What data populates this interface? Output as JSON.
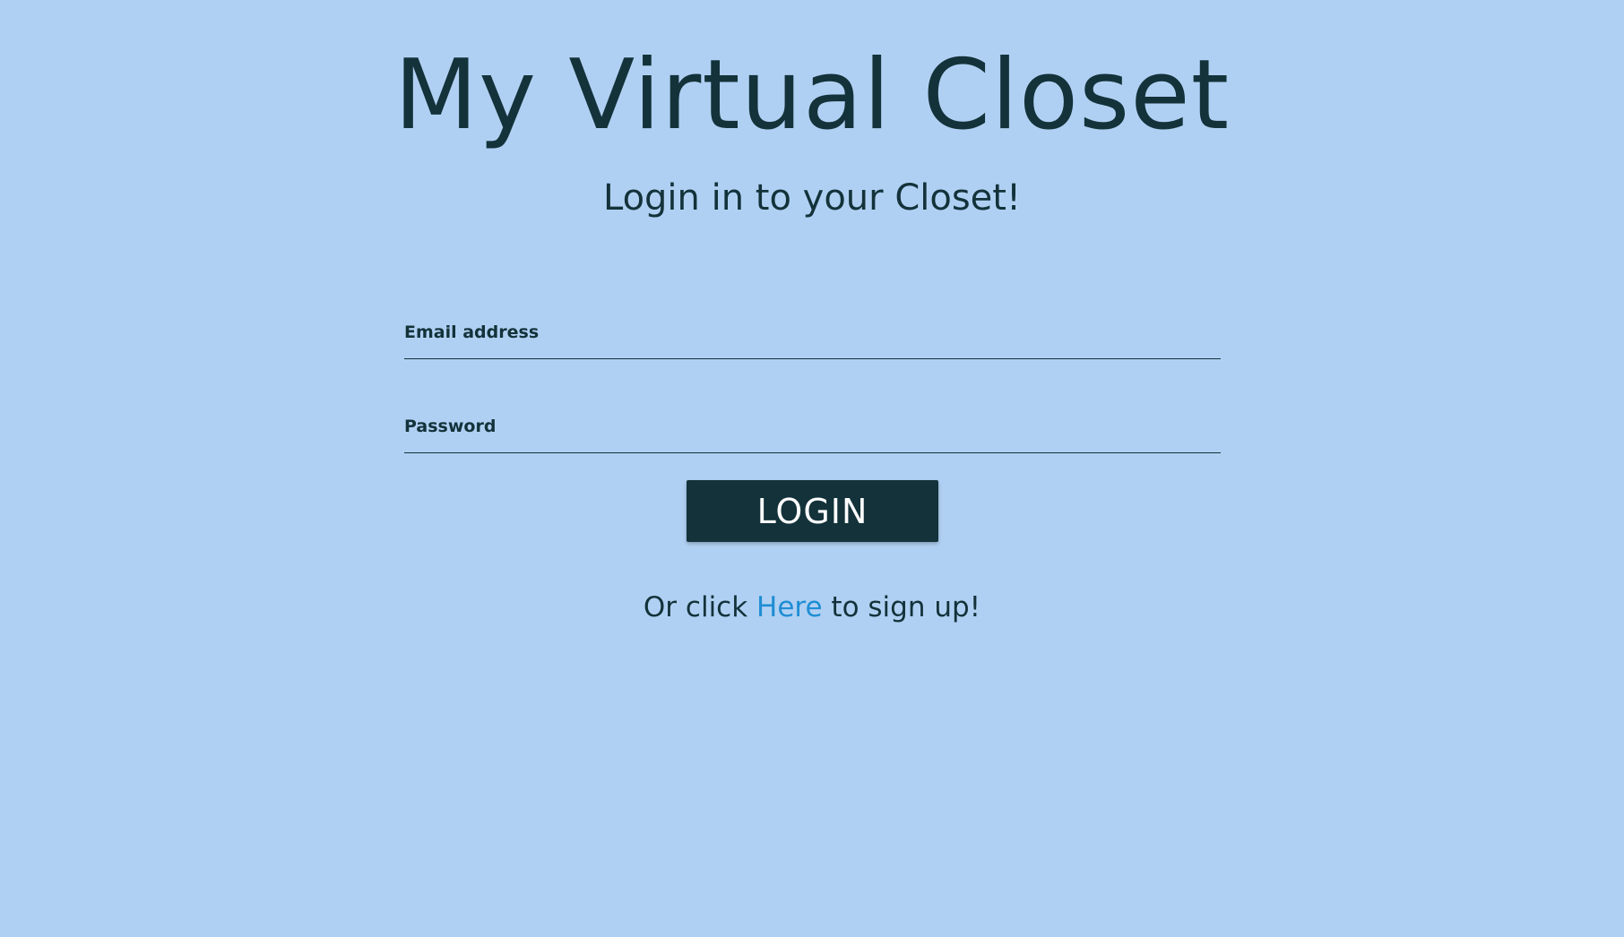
{
  "header": {
    "title": "My Virtual Closet",
    "subtitle": "Login in to your Closet!"
  },
  "form": {
    "email_label": "Email address",
    "email_value": "",
    "password_label": "Password",
    "password_value": "",
    "login_label": "LOGIN"
  },
  "signup": {
    "prefix": "Or click ",
    "link_text": "Here",
    "suffix": " to sign up!"
  },
  "colors": {
    "background": "#b0d0f3",
    "text": "#13323a",
    "button": "#13323a",
    "link": "#1f8ed3"
  }
}
